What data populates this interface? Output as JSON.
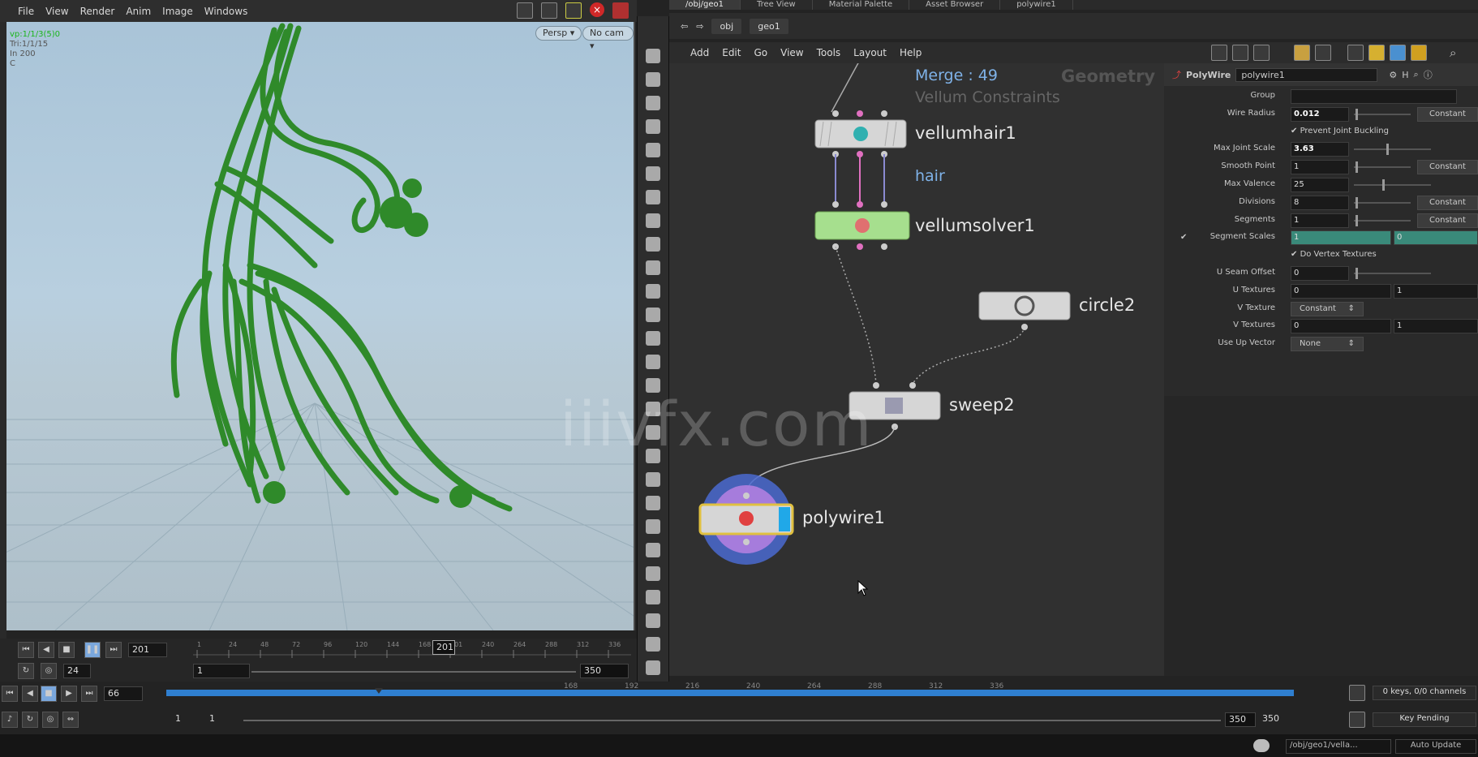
{
  "viewport_menu": [
    "File",
    "View",
    "Render",
    "Anim",
    "Image",
    "Windows"
  ],
  "viewport": {
    "info": [
      "vp:1/1/3(5)0",
      "Tri:1/1/15",
      "In 200",
      "C"
    ],
    "persp_label": "Persp ▾",
    "cam_label": "No cam ▾"
  },
  "viewport_timeline": {
    "frame": "201",
    "ticks": [
      "1",
      "24",
      "48",
      "72",
      "96",
      "120",
      "144",
      "168",
      "201",
      "240",
      "264",
      "288",
      "312",
      "336"
    ],
    "current": "201",
    "fps": "24",
    "start": "1",
    "end": "350"
  },
  "tabs": [
    "/obj/geo1",
    "Tree View",
    "Material Palette",
    "Asset Browser",
    "polywire1"
  ],
  "path": {
    "obj": "obj",
    "geo": "geo1"
  },
  "net_menu": [
    "Add",
    "Edit",
    "Go",
    "View",
    "Tools",
    "Layout",
    "Help"
  ],
  "network": {
    "context_label": "Geometry",
    "merge_label": "Merge : 49",
    "constraints_label": "Vellum Constraints",
    "nodes": {
      "vellumhair": "vellumhair1",
      "hair_label": "hair",
      "vellumsolver": "vellumsolver1",
      "circle": "circle2",
      "sweep": "sweep2",
      "polywire": "polywire1"
    }
  },
  "params": {
    "node_type": "PolyWire",
    "node_name": "polywire1",
    "rows": [
      {
        "label": "Group",
        "value": "",
        "kind": "field"
      },
      {
        "label": "Wire Radius",
        "value": "0.012",
        "kind": "field-bold",
        "button": "Constant"
      },
      {
        "label": "",
        "value": "Prevent Joint Buckling",
        "kind": "check"
      },
      {
        "label": "Max Joint Scale",
        "value": "3.63",
        "kind": "field-bold"
      },
      {
        "label": "Smooth Point",
        "value": "1",
        "kind": "field",
        "button": "Constant"
      },
      {
        "label": "Max Valence",
        "value": "25",
        "kind": "field"
      },
      {
        "label": "Divisions",
        "value": "8",
        "kind": "field",
        "button": "Constant"
      },
      {
        "label": "Segments",
        "value": "1",
        "kind": "field",
        "button": "Constant"
      },
      {
        "label": "Segment Scales",
        "value": "1",
        "value2": "0",
        "kind": "teal"
      },
      {
        "label": "",
        "value": "Do Vertex Textures",
        "kind": "check"
      },
      {
        "label": "U Seam Offset",
        "value": "0",
        "kind": "field"
      },
      {
        "label": "U Textures",
        "value": "0",
        "value2": "1",
        "kind": "pair"
      },
      {
        "label": "V Texture",
        "value": "Constant",
        "kind": "drop"
      },
      {
        "label": "V Textures",
        "value": "0",
        "value2": "1",
        "kind": "pair"
      },
      {
        "label": "Use Up Vector",
        "value": "None",
        "kind": "drop"
      }
    ]
  },
  "global_timeline": {
    "frame": "66",
    "ticks": [
      "168",
      "192",
      "216",
      "240",
      "264",
      "288",
      "312",
      "336"
    ],
    "start": "1",
    "start2": "1",
    "end": "350",
    "end2": "350",
    "keys": "0 keys, 0/0 channels",
    "key_pending": "Key Pending",
    "auto_update": "Auto Update",
    "status_path": "/obj/geo1/vella..."
  },
  "watermark": "iiivfx.com",
  "colors": {
    "hair_green": "#2f8a2a",
    "node_gray": "#d0d0d0",
    "solver_green": "#9fd987",
    "accent_blue": "#7fb2e8",
    "timeline_blue": "#2f7fd0"
  }
}
